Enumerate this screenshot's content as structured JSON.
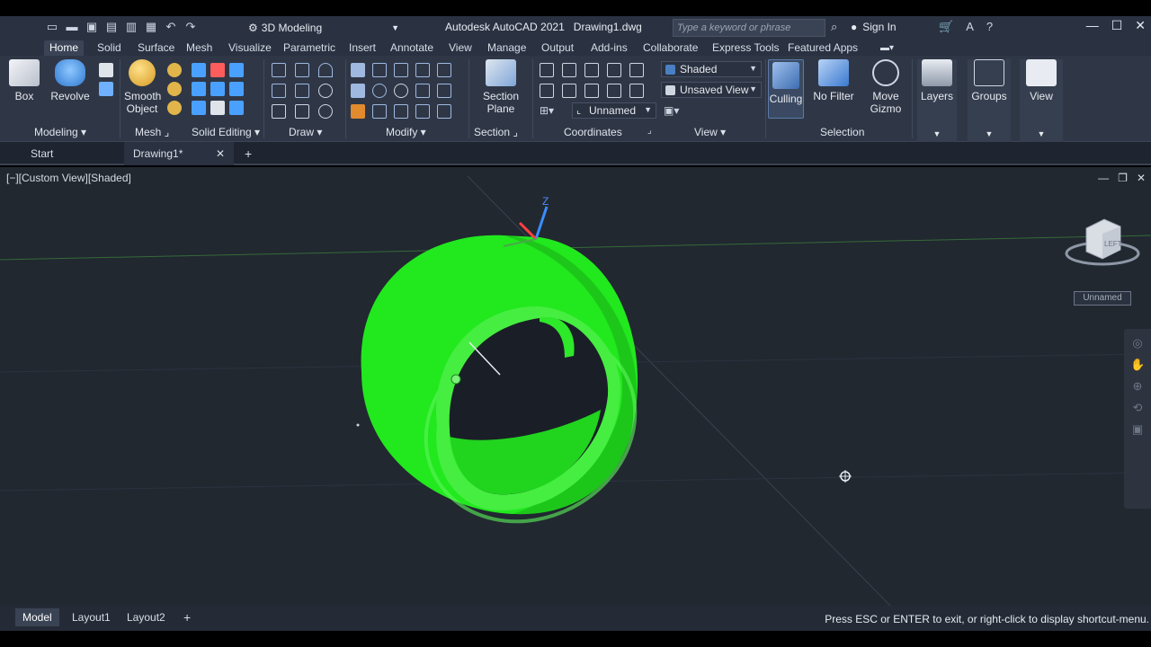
{
  "app": {
    "workspace": "3D Modeling",
    "title": "Autodesk AutoCAD 2021",
    "filename": "Drawing1.dwg",
    "search_placeholder": "Type a keyword or phrase",
    "signin": "Sign In"
  },
  "ribbon_tabs": [
    "Home",
    "Solid",
    "Surface",
    "Mesh",
    "Visualize",
    "Parametric",
    "Insert",
    "Annotate",
    "View",
    "Manage",
    "Output",
    "Add-ins",
    "Collaborate",
    "Express Tools",
    "Featured Apps"
  ],
  "ribbon": {
    "box": "Box",
    "revolve": "Revolve",
    "smooth_object": [
      "Smooth",
      "Object"
    ],
    "section_plane": [
      "Section",
      "Plane"
    ],
    "culling": "Culling",
    "no_filter": "No Filter",
    "move_gizmo": [
      "Move",
      "Gizmo"
    ],
    "layers": "Layers",
    "groups": "Groups",
    "view": "View",
    "visual_style": "Shaded",
    "named_view": "Unsaved View",
    "ucs": "Unnamed",
    "panels": {
      "modeling": "Modeling",
      "mesh": "Mesh",
      "solid_editing": "Solid Editing",
      "draw": "Draw",
      "modify": "Modify",
      "section": "Section",
      "coordinates": "Coordinates",
      "view": "View",
      "selection": "Selection"
    }
  },
  "file_tabs": {
    "start": "Start",
    "drawing": "Drawing1*"
  },
  "viewport": {
    "label": "[−][Custom View][Shaded]",
    "viewcube_face": "LEFT",
    "viewcube_named": "Unnamed",
    "ucs_z": "Z"
  },
  "layout_tabs": [
    "Model",
    "Layout1",
    "Layout2"
  ],
  "status_message": "Press ESC or ENTER to exit, or right-click to display shortcut-menu.",
  "colors": {
    "solid": "#22e81e",
    "background": "#212830",
    "ribbon": "#2f3747"
  }
}
